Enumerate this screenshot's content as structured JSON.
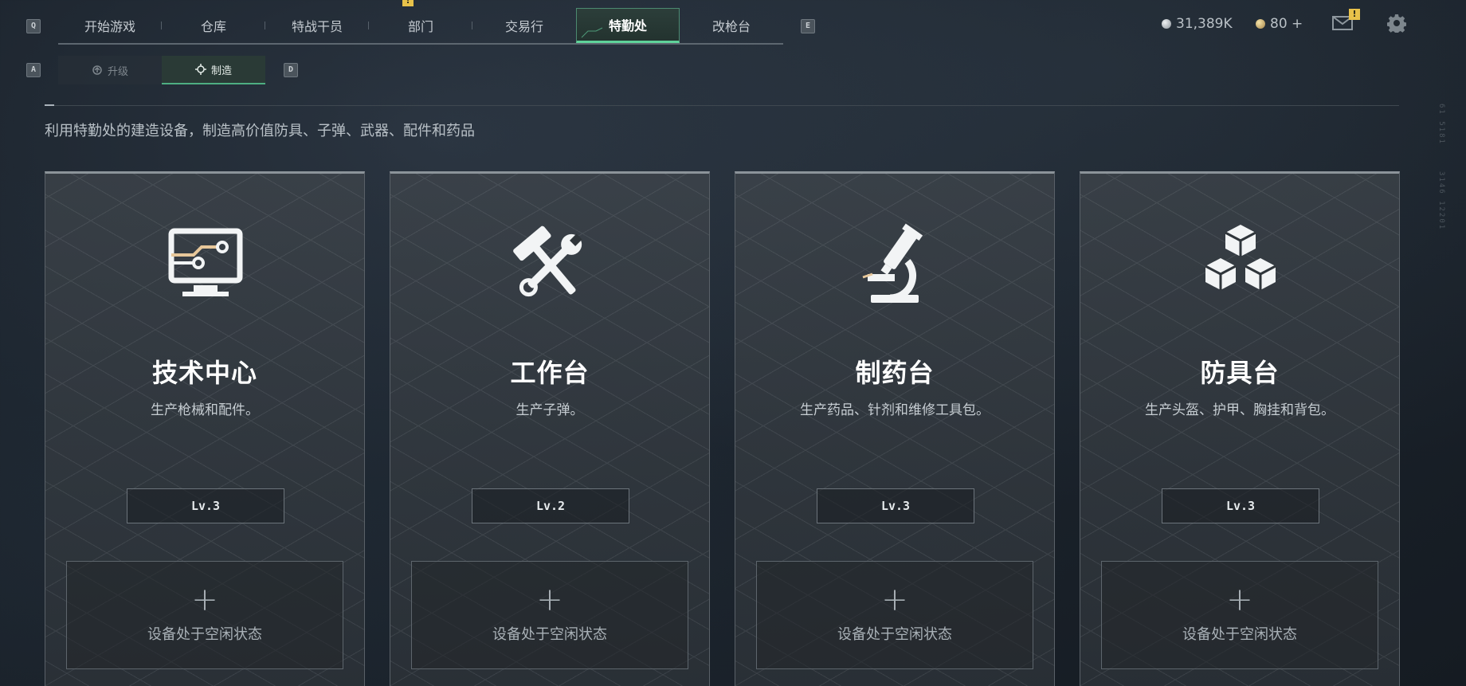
{
  "keyhints": {
    "q": "Q",
    "e": "E",
    "a": "A",
    "d": "D"
  },
  "topnav": {
    "tabs": [
      {
        "label": "开始游戏",
        "active": false
      },
      {
        "label": "仓库",
        "active": false
      },
      {
        "label": "特战干员",
        "active": false
      },
      {
        "label": "部门",
        "active": false,
        "alert": "!"
      },
      {
        "label": "交易行",
        "active": false
      },
      {
        "label": "特勤处",
        "active": true
      },
      {
        "label": "改枪台",
        "active": false
      }
    ]
  },
  "header_right": {
    "silver_amount": "31,389K",
    "gold_amount": "80 +",
    "mail_alert": "!",
    "icons": [
      "coin-silver-icon",
      "coin-gold-icon",
      "mail-icon",
      "settings-gear-icon"
    ]
  },
  "subtabs": [
    {
      "label": "升级",
      "icon": "upgrade-icon",
      "active": false
    },
    {
      "label": "制造",
      "icon": "craft-icon",
      "active": true
    }
  ],
  "subtitle": "利用特勤处的建造设备，制造高价值防具、子弹、武器、配件和药品",
  "side_text": {
    "top": "61 5181",
    "bottom": "3146 12201"
  },
  "cards": [
    {
      "title": "技术中心",
      "desc": "生产枪械和配件。",
      "level": "Lv.3",
      "icon": "tech-center-computer-icon",
      "slot_text": "设备处于空闲状态",
      "slot_plus": "+"
    },
    {
      "title": "工作台",
      "desc": "生产子弹。",
      "level": "Lv.2",
      "icon": "workbench-hammer-wrench-icon",
      "slot_text": "设备处于空闲状态",
      "slot_plus": "+"
    },
    {
      "title": "制药台",
      "desc": "生产药品、针剂和维修工具包。",
      "level": "Lv.3",
      "icon": "pharmacy-microscope-icon",
      "slot_text": "设备处于空闲状态",
      "slot_plus": "+"
    },
    {
      "title": "防具台",
      "desc": "生产头盔、护甲、胸挂和背包。",
      "level": "Lv.3",
      "icon": "armor-bench-boxes-icon",
      "slot_text": "设备处于空闲状态",
      "slot_plus": "+"
    }
  ],
  "colors": {
    "accent_green": "#5fd39a",
    "alert_yellow": "#e8c24a",
    "background": "#1b232c"
  }
}
